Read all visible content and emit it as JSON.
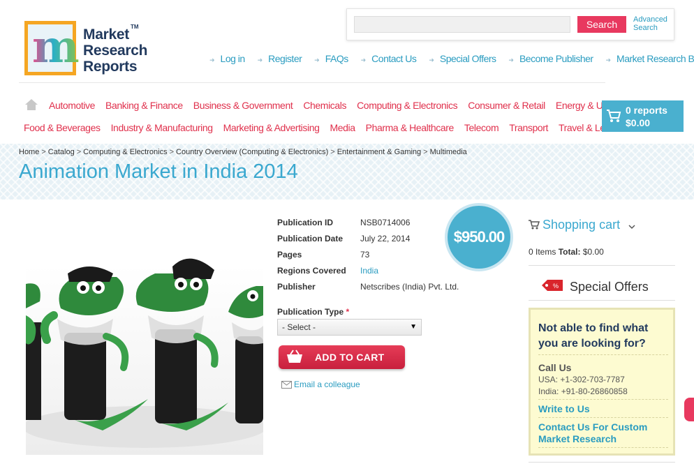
{
  "logo": {
    "letter": "m",
    "line1": "Market",
    "line2": "Research",
    "line3": "Reports",
    "tm": "TM"
  },
  "search": {
    "placeholder": "",
    "button": "Search",
    "advanced_line1": "Advanced",
    "advanced_line2": "Search"
  },
  "top_links": [
    "Log in",
    "Register",
    "FAQs",
    "Contact Us",
    "Special Offers",
    "Become Publisher",
    "Market Research Blog"
  ],
  "categories_row1": [
    "Automotive",
    "Banking & Finance",
    "Business & Government",
    "Chemicals",
    "Computing & Electronics",
    "Consumer & Retail",
    "Energy & Utilities"
  ],
  "categories_row2": [
    "Food & Beverages",
    "Industry & Manufacturing",
    "Marketing & Advertising",
    "Media",
    "Pharma & Healthcare",
    "Telecom",
    "Transport",
    "Travel & Leisure"
  ],
  "cart": {
    "reports": "0 reports",
    "total": "$0.00"
  },
  "breadcrumb": [
    "Home",
    "Catalog",
    "Computing & Electronics",
    "Country Overview (Computing & Electronics)",
    "Entertainment & Gaming",
    "Multimedia"
  ],
  "page_title": "Animation Market in India 2014",
  "details": {
    "publication_id_label": "Publication ID",
    "publication_id": "NSB0714006",
    "publication_date_label": "Publication Date",
    "publication_date": "July 22, 2014",
    "pages_label": "Pages",
    "pages": "73",
    "regions_label": "Regions Covered",
    "regions": "India",
    "publisher_label": "Publisher",
    "publisher": "Netscribes (India) Pvt. Ltd."
  },
  "price": "$950.00",
  "publication_type": {
    "label": "Publication Type",
    "required": "*",
    "selected": "- Select -"
  },
  "add_to_cart": "ADD TO CART",
  "email_colleague": "Email a colleague",
  "sidebar": {
    "shopping_cart": "Shopping cart",
    "items": "0 Items",
    "total_label": "Total:",
    "total_value": "$0.00",
    "special_offers": "Special Offers",
    "help_question": "Not able to find what you are looking for?",
    "call_us": "Call Us",
    "usa_phone": "USA: +1-302-703-7787",
    "india_phone": "India: +91-80-26860858",
    "write_us": "Write to Us",
    "custom_research": "Contact Us For Custom Market Research"
  },
  "colors": {
    "accent_blue": "#3aa8cf",
    "accent_red": "#e0304c",
    "cart_blue": "#4ab0cf",
    "help_bg": "#fdfbd1"
  }
}
